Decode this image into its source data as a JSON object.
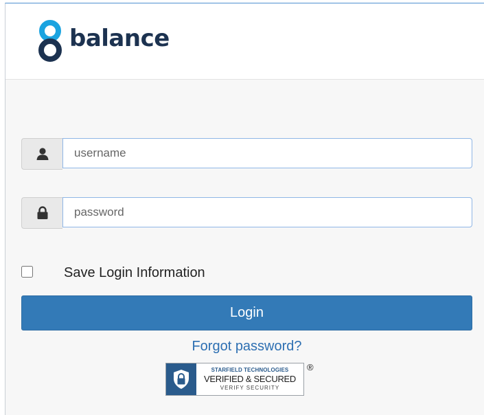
{
  "brand": {
    "name": "balance",
    "logo_icon": "figure-eight-logo-icon",
    "colors": {
      "logo_dark": "#1c3250",
      "logo_blue": "#1aa3e0",
      "primary": "#337ab7",
      "link": "#2d6fb2"
    }
  },
  "login_form": {
    "username": {
      "icon": "user-icon",
      "value": "",
      "placeholder": "username"
    },
    "password": {
      "icon": "lock-icon",
      "value": "",
      "placeholder": "password"
    },
    "save_login": {
      "label": "Save Login Information",
      "checked": false
    },
    "submit_label": "Login",
    "forgot_label": "Forgot password?"
  },
  "security_seal": {
    "icon": "padlock-icon",
    "line1": "STARFIELD TECHNOLOGIES",
    "line2": "VERIFIED & SECURED",
    "line3": "VERIFY SECURITY",
    "registered_mark": "®"
  }
}
